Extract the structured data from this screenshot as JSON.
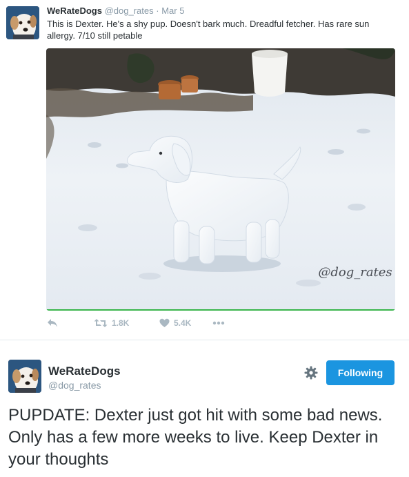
{
  "quoted_tweet": {
    "user_name": "WeRateDogs",
    "handle": "@dog_rates",
    "separator": "·",
    "date": "Mar 5",
    "text": "This is Dexter. He's a shy pup. Doesn't bark much. Dreadful fetcher. Has rare sun allergy. 7/10 still petable",
    "media": {
      "watermark": "@dog_rates"
    },
    "actions": {
      "reply_icon": "reply-icon",
      "retweet_icon": "retweet-icon",
      "retweet_count": "1.8K",
      "like_icon": "heart-icon",
      "like_count": "5.4K",
      "more_icon": "more-icon"
    }
  },
  "main_tweet": {
    "user_name": "WeRateDogs",
    "handle": "@dog_rates",
    "settings_icon": "gear-icon",
    "follow_label": "Following",
    "text": "PUPDATE: Dexter just got hit with some bad news. Only has a few more weeks to live. Keep Dexter in your thoughts"
  },
  "colors": {
    "accent": "#1b95e0",
    "muted_text": "#8899a6",
    "action_icon": "#aab8c2",
    "body_text": "#292f33"
  }
}
